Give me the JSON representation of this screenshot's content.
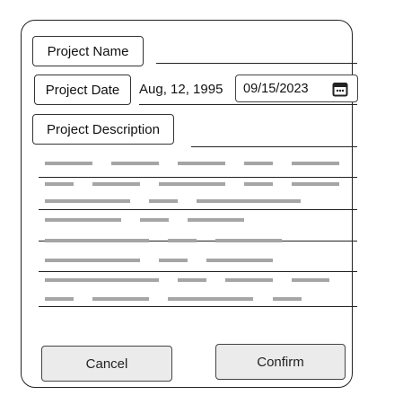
{
  "form": {
    "name_label": "Project Name",
    "date_label": "Project Date",
    "date_text": "Aug, 12, 1995",
    "date_input_value": "09/15/2023",
    "description_label": "Project Description"
  },
  "buttons": {
    "cancel": "Cancel",
    "confirm": "Confirm"
  },
  "icons": {
    "date_picker": "calendar-icon"
  },
  "colors": {
    "placeholder_bar": "#a5a5a5",
    "button_bg": "#ebebeb",
    "border": "#222222"
  }
}
